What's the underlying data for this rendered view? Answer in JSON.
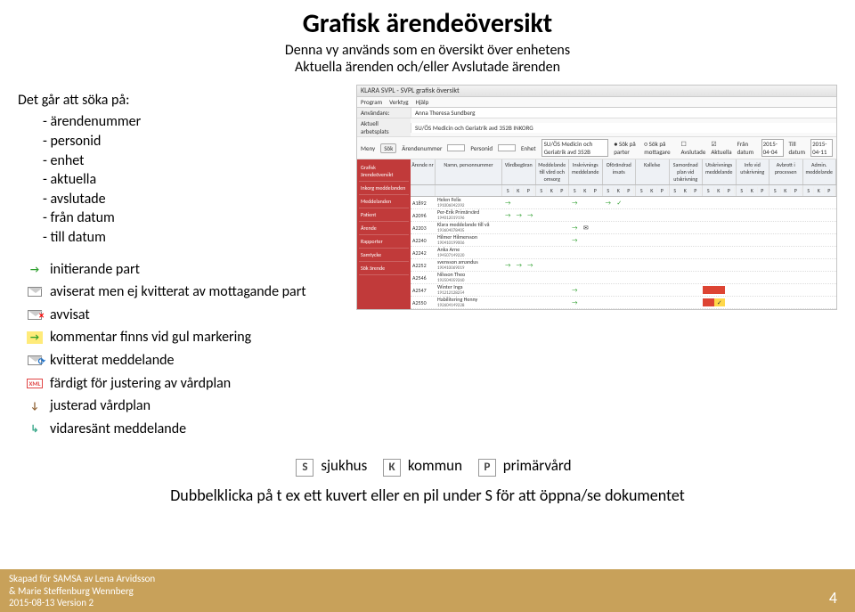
{
  "title": "Grafisk ärendeöversikt",
  "subtitle_line1": "Denna vy används som en översikt över enhetens",
  "subtitle_line2": "Aktuella ärenden och/eller Avslutade ärenden",
  "search_intro": "Det går att söka på:",
  "search_items": [
    "ärendenummer",
    "personid",
    "enhet",
    "aktuella",
    "avslutade",
    "från datum",
    "till datum"
  ],
  "icon_legend": {
    "initierande": "initierande part",
    "aviserat": "aviserat men ej kvitterat av mottagande part",
    "avvisat": "avvisat",
    "kommentar": "kommentar finns vid gul markering",
    "kvitterat": "kvitterat meddelande",
    "fardigt": "färdigt för justering av vårdplan",
    "justerad": "justerad vårdplan",
    "vidaresant": "vidaresänt meddelande"
  },
  "letter_legend": {
    "S": "sjukhus",
    "K": "kommun",
    "P": "primärvård"
  },
  "instruction": "Dubbelklicka på t ex ett kuvert eller en pil under S för att öppna/se dokumentet",
  "footer": {
    "line1": "Skapad för SAMSA av Lena Arvidsson",
    "line2": "& Marie Steffenburg Wennberg",
    "line3": "2015-08-13 Version 2",
    "page": "4"
  },
  "screenshot": {
    "window_title": "KLARA SVPL - SVPL grafisk översikt",
    "menu": [
      "Program",
      "Verktyg",
      "Hjälp"
    ],
    "anvandare_label": "Användare:",
    "anvandare_value": "Anna Theresa Sundberg",
    "arbetsplats_label": "Aktuell arbetsplats",
    "arbetsplats_value": "SU/ÖS Medicin och Geriatrik avd 352B INKORG",
    "meny_label": "Meny",
    "sok_btn": "Sök",
    "fields": {
      "arendenummer": "Ärendenummer",
      "personid": "Personid",
      "enhet": "Enhet",
      "enhet_value": "SU/ÖS Medicin och Geriatrik avd 352B",
      "sok_parter": "Sök på parter",
      "sok_mottagare": "Sök på mottagare",
      "avslutade": "Avslutade",
      "aktuella": "Aktuella",
      "fran_datum": "Från datum",
      "fran_value": "2015-04-04",
      "till_datum": "Till datum",
      "till_value": "2015-04-11"
    },
    "sidebar_items": [
      "Grafisk ärendeöversikt",
      "Inkorg meddelanden",
      "Meddelanden",
      "Patient",
      "Ärende",
      "Rapporter",
      "Samtycke",
      "Sök ärende"
    ],
    "columns": [
      "Ärende nr",
      "Namn, personnummer",
      "Vårdbegäran",
      "Meddelande till vård och omsorg",
      "Inskrivnings meddelande",
      "Oförändrad insats",
      "Kallelse",
      "Samordnad plan vid utskrivning",
      "Utskrivnings meddelande",
      "Info vid utskrivning",
      "Avbrott i processen",
      "Admin. meddelande"
    ],
    "skp_labels": [
      "S",
      "K",
      "P"
    ],
    "rows": [
      {
        "nr": "A1892",
        "name": "Helen Felix",
        "pn": "191006042392"
      },
      {
        "nr": "A2096",
        "name": "Per-Erik Primärvärd",
        "pn": "194012019196"
      },
      {
        "nr": "A2203",
        "name": "Klara meddelande till vå",
        "pn": "193604078405"
      },
      {
        "nr": "A2240",
        "name": "Hilmer Hilmersson",
        "pn": "190410199006"
      },
      {
        "nr": "A2242",
        "name": "Anka Arne",
        "pn": "194507149220"
      },
      {
        "nr": "A2252",
        "name": "svensson amandus",
        "pn": "190410069019"
      },
      {
        "nr": "A2546",
        "name": "Nilsson Theo",
        "pn": "192504059260"
      },
      {
        "nr": "A2547",
        "name": "Winter Inga",
        "pn": "191212128254"
      },
      {
        "nr": "A2550",
        "name": "Habilitering Henny",
        "pn": "192604149228"
      }
    ]
  }
}
